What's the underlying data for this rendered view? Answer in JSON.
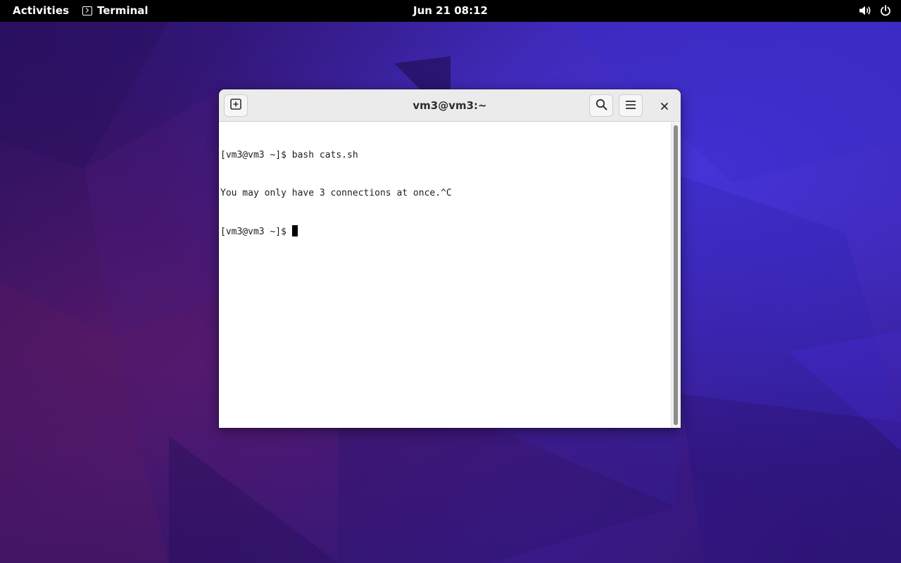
{
  "topbar": {
    "activities_label": "Activities",
    "app_name": "Terminal",
    "app_icon": "terminal-icon",
    "clock": "Jun 21  08:12",
    "tray_icons": [
      "volume-icon",
      "power-icon"
    ]
  },
  "window": {
    "title": "vm3@vm3:~",
    "buttons": {
      "new_tab_icon": "new-tab-icon",
      "search_icon": "search-icon",
      "menu_icon": "hamburger-menu-icon",
      "close_icon": "close-icon"
    }
  },
  "terminal": {
    "lines": [
      "[vm3@vm3 ~]$ bash cats.sh",
      "You may only have 3 connections at once.^C",
      "[vm3@vm3 ~]$ "
    ]
  },
  "colors": {
    "topbar_bg": "#000000",
    "headerbar_bg": "#ebebeb",
    "terminal_bg": "#ffffff",
    "terminal_fg": "#1e1e1e",
    "wallpaper_primary": "#3a1880",
    "wallpaper_accent": "#4a34d6"
  }
}
